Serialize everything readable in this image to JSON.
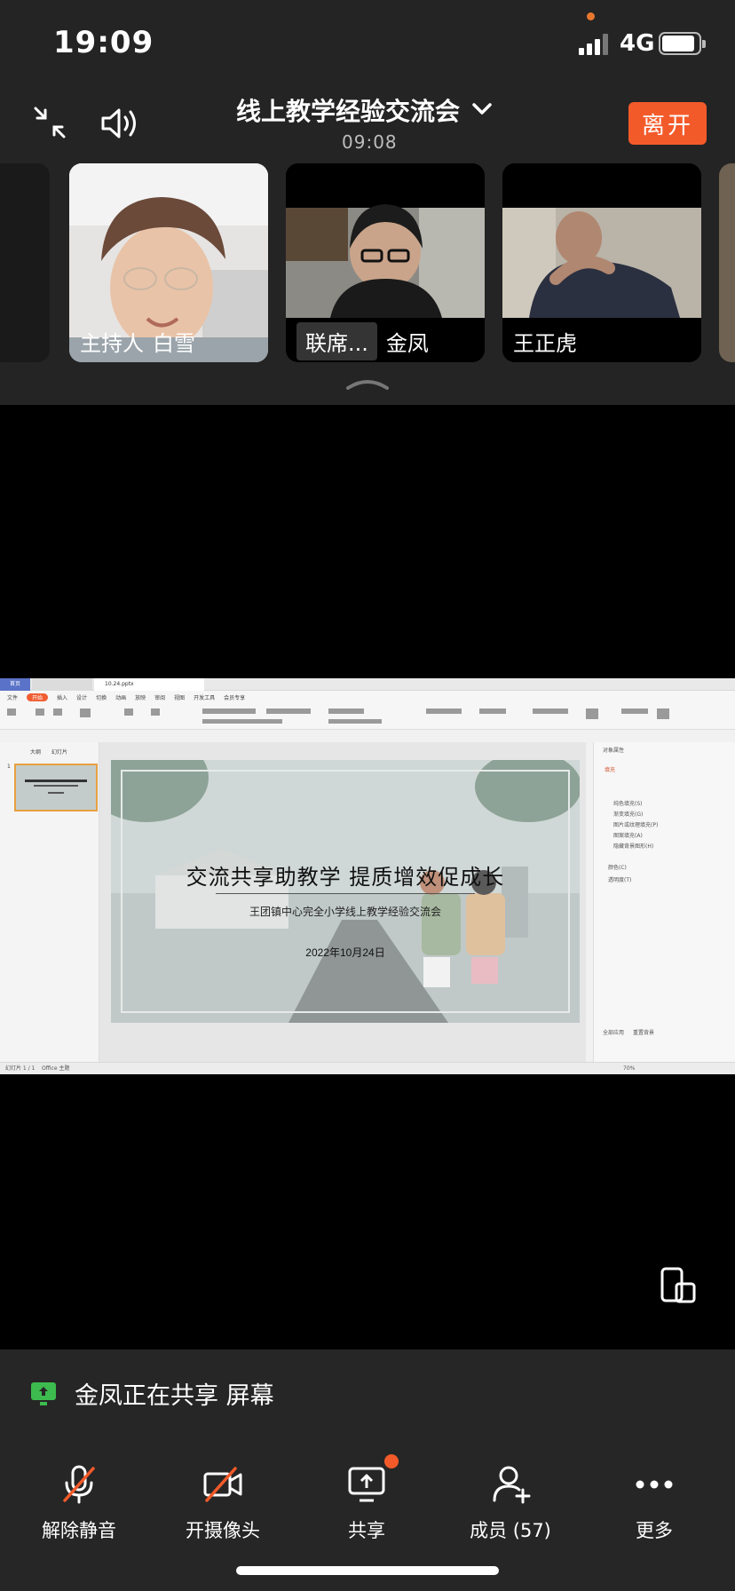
{
  "status_bar": {
    "time": "19:09",
    "network": "4G"
  },
  "meeting": {
    "title": "线上教学经验交流会",
    "duration": "09:08",
    "leave_label": "离开"
  },
  "participants": [
    {
      "role": "主持人",
      "name": "白雪"
    },
    {
      "role": "联席...",
      "name": "金凤"
    },
    {
      "role": "",
      "name": "王正虎"
    }
  ],
  "shared_screen": {
    "doc_tab": "10.24.pptx",
    "home_tab": "首页",
    "menus": [
      "文件",
      "开始",
      "插入",
      "设计",
      "切换",
      "动画",
      "放映",
      "审阅",
      "视图",
      "开发工具",
      "会员专享"
    ],
    "left_tabs": [
      "大纲",
      "幻灯片"
    ],
    "slide_title": "交流共享助教学 提质增效促成长",
    "slide_subtitle": "王团镇中心完全小学线上教学经验交流会",
    "slide_date": "2022年10月24日",
    "right_panel_title": "对象属性",
    "right_panel_tab": "填充",
    "fill_options": [
      "纯色填充(S)",
      "渐变填充(G)",
      "图片或纹理填充(P)",
      "图案填充(A)",
      "隐藏背景图形(H)"
    ],
    "color_label": "颜色(C)",
    "transparency_label": "透明度(T)",
    "apply_all": "全部应用",
    "reset_bg": "重置背景",
    "status_left": "幻灯片 1 / 1",
    "status_theme": "Office 主题",
    "zoom": "70%"
  },
  "share_notice": "金凤正在共享 屏幕",
  "controls": {
    "mute": "解除静音",
    "camera": "开摄像头",
    "share": "共享",
    "members": "成员 (57)",
    "more": "更多"
  },
  "colors": {
    "accent": "#f35a2a",
    "share_green": "#3dbb4e"
  }
}
